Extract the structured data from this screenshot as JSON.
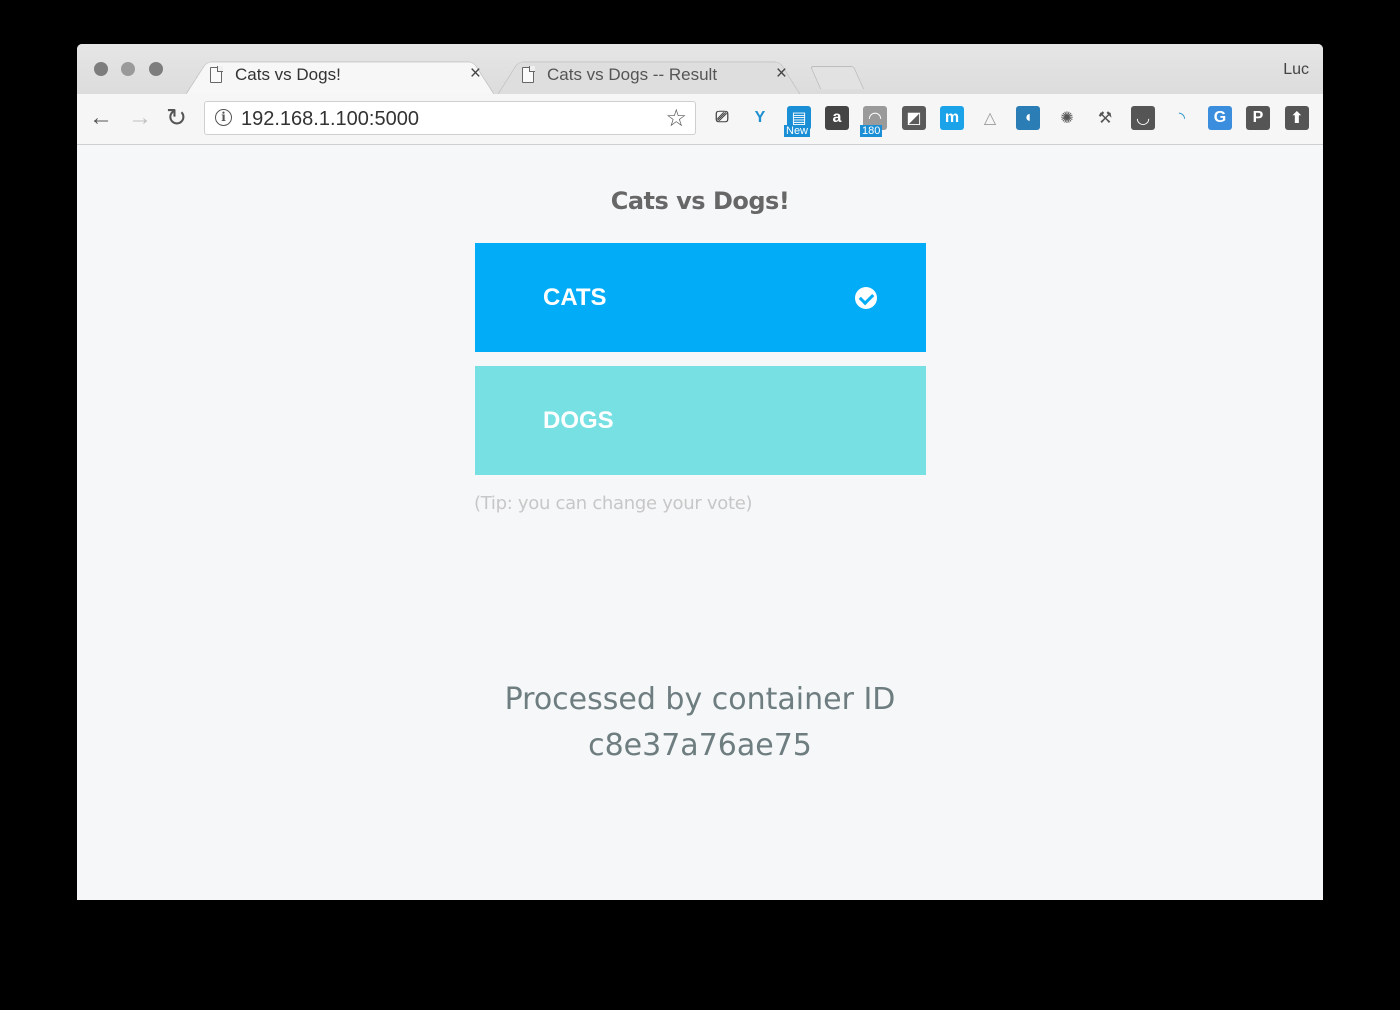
{
  "window": {
    "controls": [
      "close",
      "minimize",
      "zoom"
    ],
    "profile_name": "Luc"
  },
  "tabs": [
    {
      "title": "Cats vs Dogs!",
      "active": true,
      "close_glyph": "×"
    },
    {
      "title": "Cats vs Dogs -- Result",
      "active": false,
      "close_glyph": "×"
    }
  ],
  "toolbar": {
    "back_glyph": "←",
    "forward_glyph": "→",
    "reload_glyph": "↻",
    "url": "192.168.1.100:5000",
    "info_glyph": "i",
    "star_glyph": "☆",
    "extensions": [
      {
        "name": "cast-icon",
        "glyph": "⎚",
        "bg": "transparent",
        "color": "#444"
      },
      {
        "name": "y-extension-icon",
        "glyph": "Y",
        "bg": "transparent",
        "color": "#1e90d0"
      },
      {
        "name": "new-extension-icon",
        "glyph": "▤",
        "bg": "#1a8fd6",
        "color": "#fff",
        "badge": "New"
      },
      {
        "name": "amazon-icon",
        "glyph": "a",
        "bg": "#444",
        "color": "#fff"
      },
      {
        "name": "rss-icon",
        "glyph": "◠",
        "bg": "#9a9a9a",
        "color": "#fff",
        "badge": "180"
      },
      {
        "name": "square-extension-icon",
        "glyph": "◩",
        "bg": "#5a5a5a",
        "color": "#fff"
      },
      {
        "name": "m-extension-icon",
        "glyph": "m",
        "bg": "#1aa3e8",
        "color": "#fff"
      },
      {
        "name": "drive-icon",
        "glyph": "△",
        "bg": "transparent",
        "color": "#999"
      },
      {
        "name": "wave-extension-icon",
        "glyph": "◖",
        "bg": "#2a7db5",
        "color": "#fff"
      },
      {
        "name": "globe-extension-icon",
        "glyph": "✺",
        "bg": "transparent",
        "color": "#555"
      },
      {
        "name": "tools-extension-icon",
        "glyph": "⚒",
        "bg": "transparent",
        "color": "#555"
      },
      {
        "name": "pocket-icon",
        "glyph": "◡",
        "bg": "#555",
        "color": "#fff"
      },
      {
        "name": "signal-extension-icon",
        "glyph": "◝",
        "bg": "transparent",
        "color": "#3399cc"
      },
      {
        "name": "translate-icon",
        "glyph": "G",
        "bg": "#3b8ede",
        "color": "#fff"
      },
      {
        "name": "p-extension-icon",
        "glyph": "P",
        "bg": "#555",
        "color": "#fff"
      },
      {
        "name": "upload-extension-icon",
        "glyph": "⬆",
        "bg": "#555",
        "color": "#fff"
      }
    ]
  },
  "page": {
    "title": "Cats vs Dogs!",
    "options": [
      {
        "label": "CATS",
        "selected": true,
        "color": "#03acf7"
      },
      {
        "label": "DOGS",
        "selected": false,
        "color": "#76e0e2"
      }
    ],
    "tip": "(Tip: you can change your vote)",
    "processed_line1": "Processed by container ID",
    "processed_line2": "c8e37a76ae75"
  }
}
